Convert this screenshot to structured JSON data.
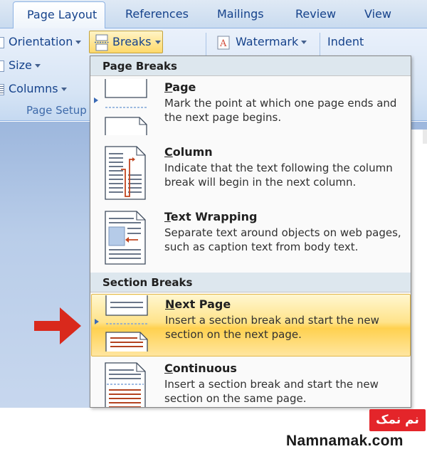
{
  "tabs": [
    {
      "label": "Page Layout",
      "active": true
    },
    {
      "label": "References",
      "active": false
    },
    {
      "label": "Mailings",
      "active": false
    },
    {
      "label": "Review",
      "active": false
    },
    {
      "label": "View",
      "active": false
    }
  ],
  "ribbon": {
    "orientation_label": "Orientation",
    "size_label": "Size",
    "columns_label": "Columns",
    "breaks_label": "Breaks",
    "watermark_label": "Watermark",
    "indent_label": "Indent",
    "group_label": "Page Setup"
  },
  "menu": {
    "page_breaks_header": "Page Breaks",
    "section_breaks_header": "Section Breaks",
    "items": [
      {
        "title_key": "P",
        "title_rest": "age",
        "desc": "Mark the point at which one page ends and the next page begins.",
        "icon": "page-break-icon",
        "highlighted": false
      },
      {
        "title_key": "C",
        "title_rest": "olumn",
        "desc": "Indicate that the text following the column break will begin in the next column.",
        "icon": "column-break-icon",
        "highlighted": false
      },
      {
        "title_key": "T",
        "title_rest": "ext Wrapping",
        "desc": "Separate text around objects on web pages, such as caption text from body text.",
        "icon": "text-wrapping-icon",
        "highlighted": false
      },
      {
        "title_key": "N",
        "title_rest": "ext Page",
        "desc": "Insert a section break and start the new section on the next page.",
        "icon": "next-page-break-icon",
        "highlighted": true
      },
      {
        "title_key": "C",
        "title_rest": "ontinuous",
        "desc": "Insert a section break and start the new section on the same page.",
        "icon": "continuous-break-icon",
        "highlighted": false
      }
    ]
  },
  "watermark": {
    "badge": "نم نمک",
    "site": "Namnamak.com"
  },
  "colors": {
    "accent_highlight": "#ffd96a",
    "annotation_arrow": "#d9291c",
    "brand_red": "#e4252a"
  }
}
